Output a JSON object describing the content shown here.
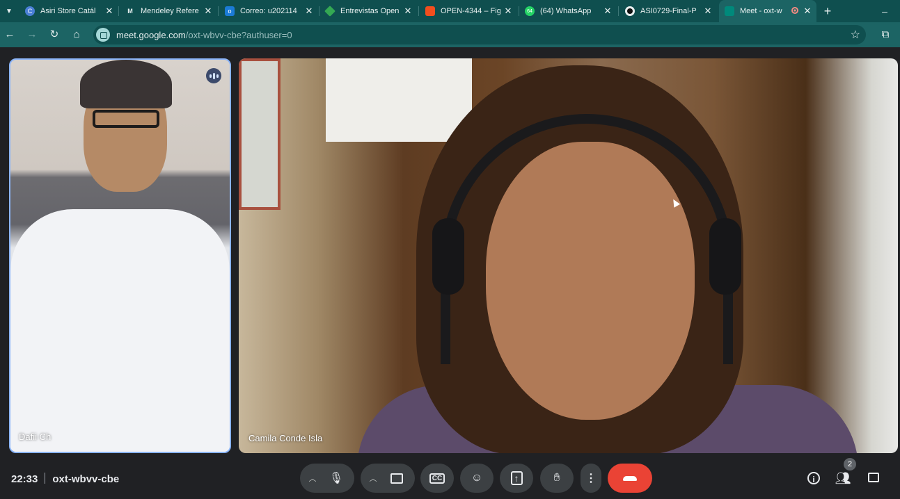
{
  "browser": {
    "tabs": [
      {
        "title": "Asiri Store Catál",
        "icon": "asiri-favicon",
        "color": "#4a7fd6"
      },
      {
        "title": "Mendeley Refere",
        "icon": "mendeley-favicon",
        "color": "#0f4f4f"
      },
      {
        "title": "Correo: u202114",
        "icon": "outlook-favicon",
        "color": "#1b7bd6"
      },
      {
        "title": "Entrevistas Open",
        "icon": "drive-favicon",
        "color": "#34a853"
      },
      {
        "title": "OPEN-4344 – Fig",
        "icon": "figma-favicon",
        "color": "#f24e1e"
      },
      {
        "title": "(64) WhatsApp",
        "icon": "whatsapp-favicon",
        "color": "#25d366",
        "badge": "64"
      },
      {
        "title": "ASI0729-Final-P",
        "icon": "github-favicon",
        "color": "#111111"
      },
      {
        "title": "Meet - oxt-w",
        "icon": "meet-favicon",
        "color": "#00897b",
        "active": true,
        "recording": true
      }
    ],
    "new_tab_glyph": "+",
    "minimize_glyph": "–",
    "url_host": "meet.google.com",
    "url_path": "/oxt-wbvv-cbe?authuser=0"
  },
  "meeting": {
    "participants": [
      {
        "name": "Dafii Ch",
        "speaking": true
      },
      {
        "name": "Camila Conde Isla",
        "speaking": false
      }
    ],
    "time": "22:33",
    "code": "oxt-wbvv-cbe",
    "people_count": "2",
    "controls": [
      "mic",
      "camera",
      "captions",
      "emoji",
      "present",
      "raise-hand",
      "more",
      "leave-call"
    ],
    "end_call_color": "#ea4335"
  }
}
